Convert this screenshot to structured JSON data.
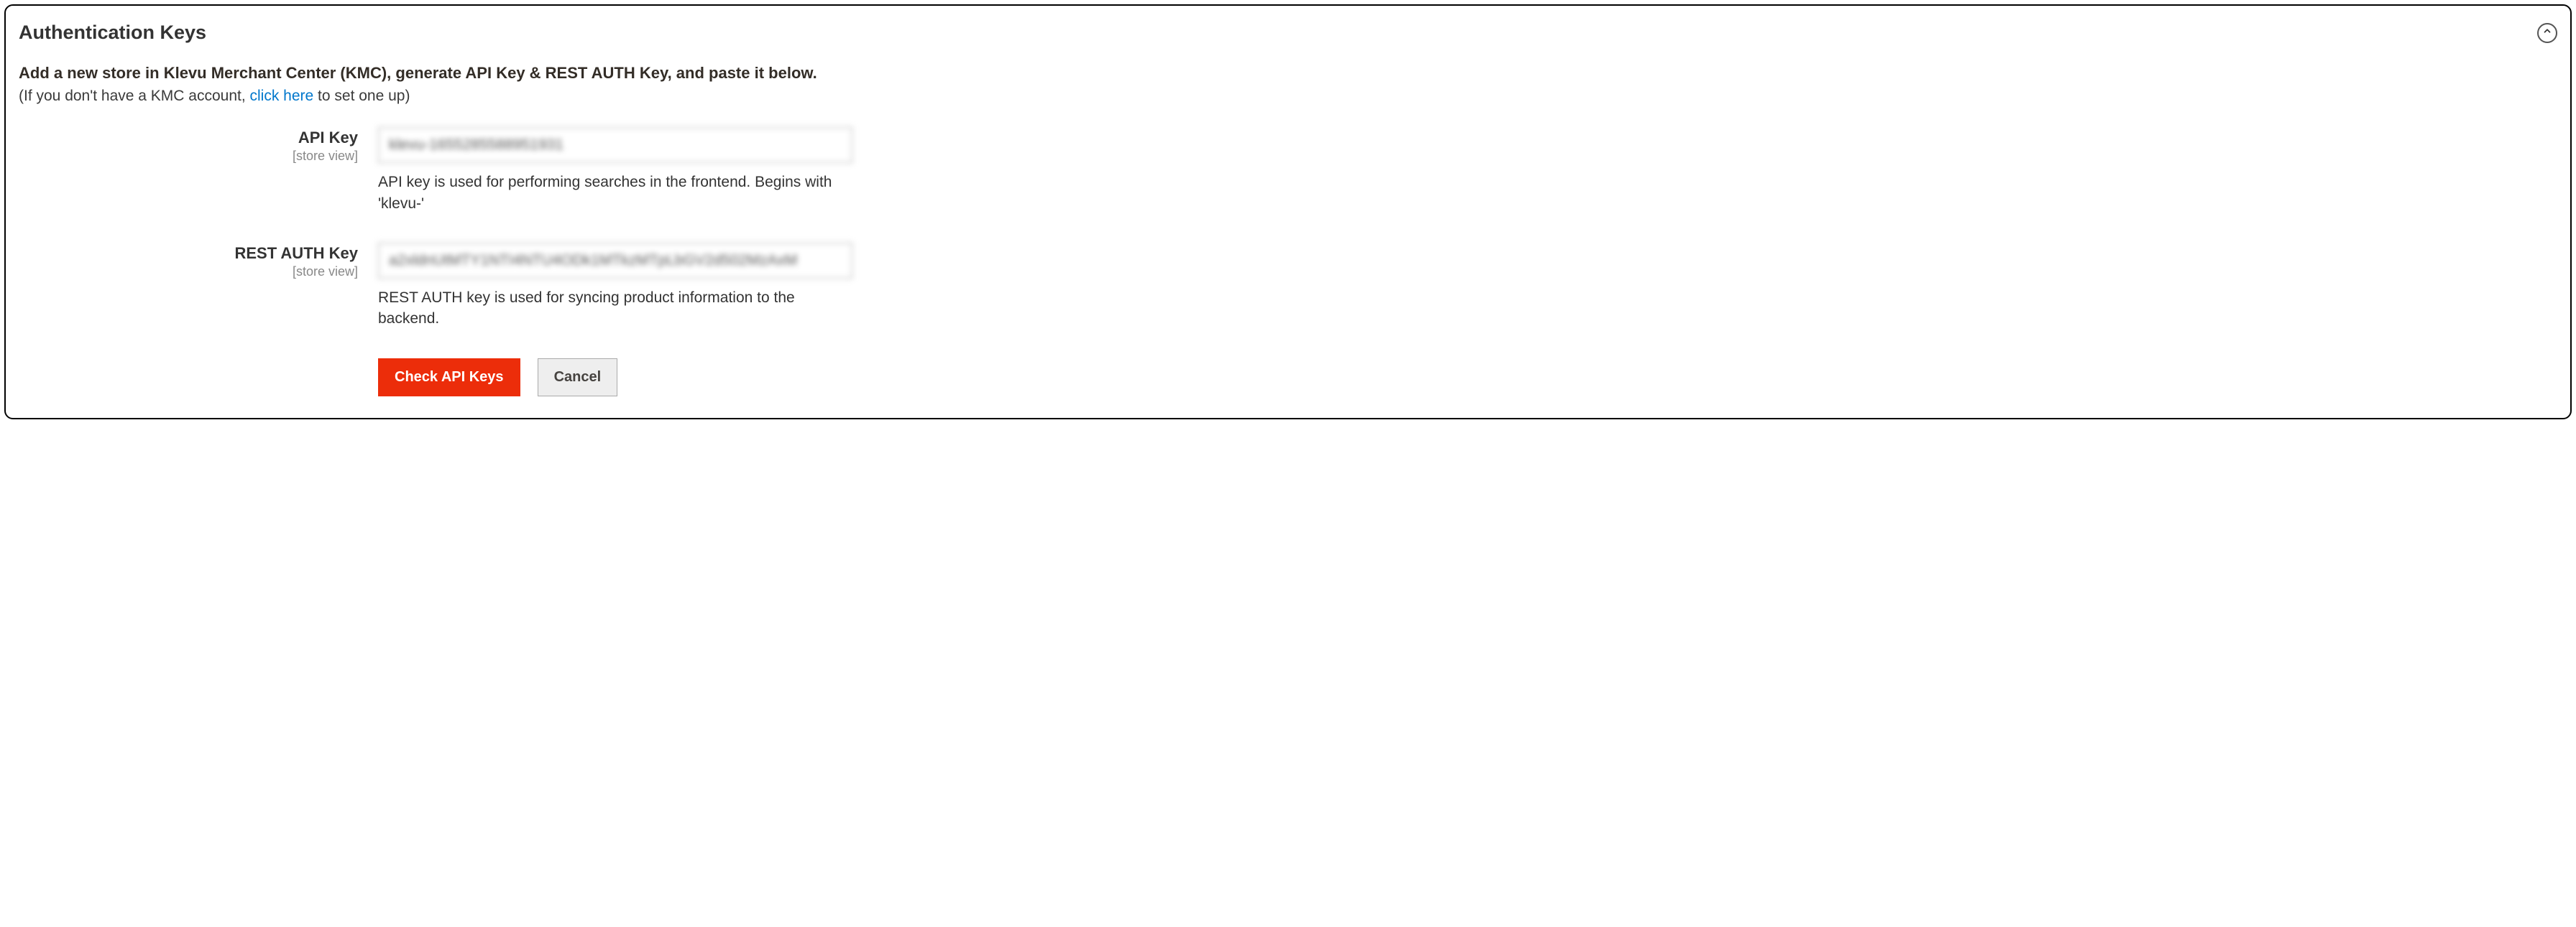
{
  "panel": {
    "title": "Authentication Keys"
  },
  "intro": {
    "bold": "Add a new store in Klevu Merchant Center (KMC), generate API Key & REST AUTH Key, and paste it below.",
    "sub_prefix": "(If you don't have a KMC account, ",
    "link_text": "click here",
    "sub_suffix": " to set one up)"
  },
  "fields": {
    "api_key": {
      "label": "API Key",
      "scope": "[store view]",
      "value": "klevu-165528558895193​1",
      "note": "API key is used for performing searches in the frontend. Begins with 'klevu-'"
    },
    "rest_auth": {
      "label": "REST AUTH Key",
      "scope": "[store view]",
      "value": "a2xldnUtMTY1NTI4NTU4ODk1MTkzMTpLbGV2d502MzAxM",
      "note": "REST AUTH key is used for syncing product information to the backend."
    }
  },
  "actions": {
    "primary": "Check API Keys",
    "secondary": "Cancel"
  }
}
